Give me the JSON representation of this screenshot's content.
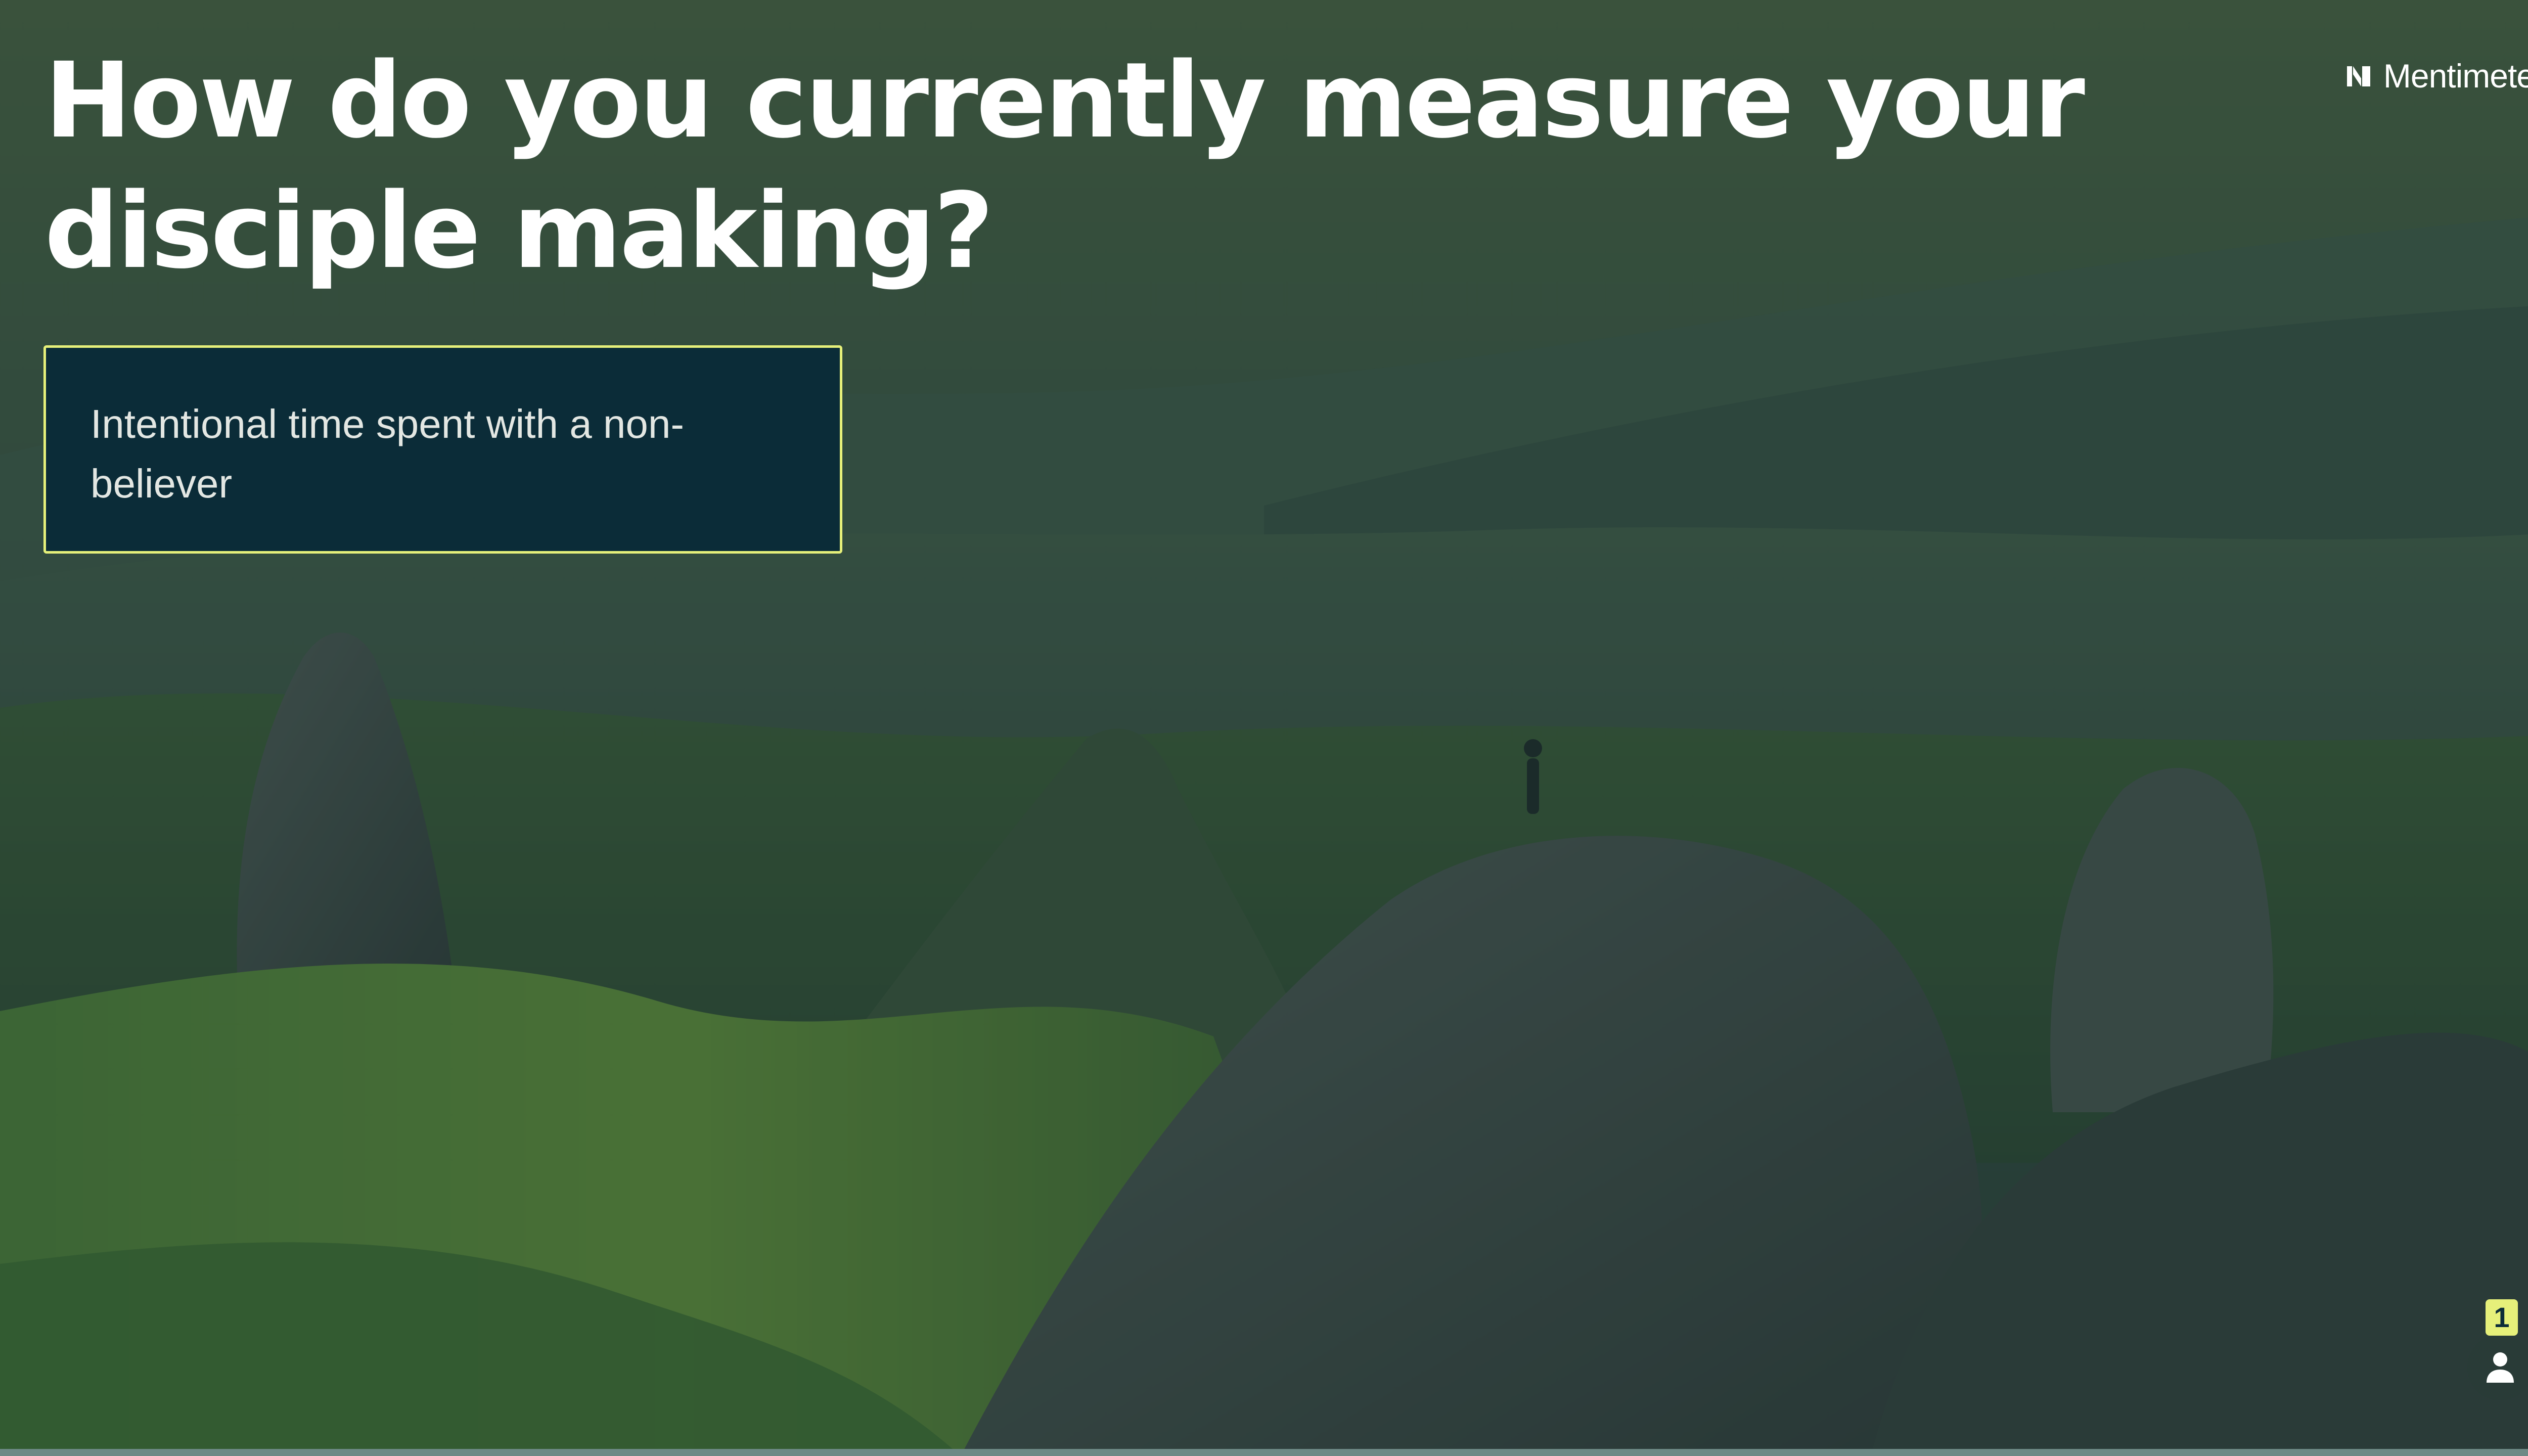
{
  "slide": {
    "question": "How do you currently measure your disciple making?",
    "answers": [
      {
        "text": "Intentional time spent with a non-believer"
      }
    ],
    "participants_count": "1"
  },
  "brand": {
    "name": "Mentimeter",
    "icon": "mentimeter-logo-icon"
  },
  "colors": {
    "accent": "#e6f07a",
    "card_background": "#0b2c38",
    "title_text": "#ffffff"
  },
  "icons": {
    "participants": "person-icon"
  }
}
